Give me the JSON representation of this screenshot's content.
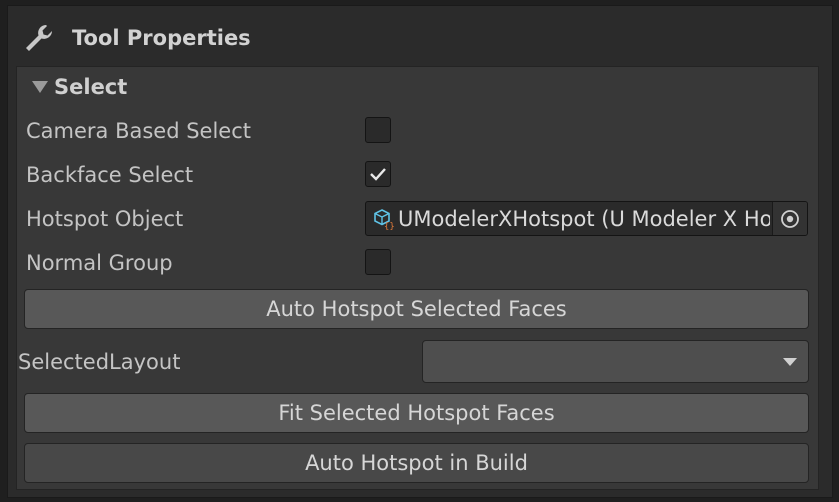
{
  "header": {
    "title": "Tool Properties",
    "icon": "wrench-icon"
  },
  "section": {
    "label": "Select",
    "expanded": true
  },
  "fields": {
    "camera_based_select": {
      "label": "Camera Based Select",
      "checked": false
    },
    "backface_select": {
      "label": "Backface Select",
      "checked": true
    },
    "hotspot_object": {
      "label": "Hotspot Object",
      "value": "UModelerXHotspot (U Modeler X Hotspot)"
    },
    "normal_group": {
      "label": "Normal Group",
      "checked": false
    }
  },
  "buttons": {
    "auto_hotspot_selected": "Auto Hotspot Selected Faces",
    "fit_selected": "Fit Selected Hotspot Faces",
    "auto_hotspot_build": "Auto Hotspot in Build"
  },
  "selected_layout": {
    "label": "SelectedLayout",
    "value": ""
  },
  "colors": {
    "background": "#383838",
    "button": "#585858",
    "field": "#2a2a2a",
    "text": "#c4c4c4",
    "icon_cyan": "#5fc3e6",
    "icon_orange": "#e07a3a"
  }
}
